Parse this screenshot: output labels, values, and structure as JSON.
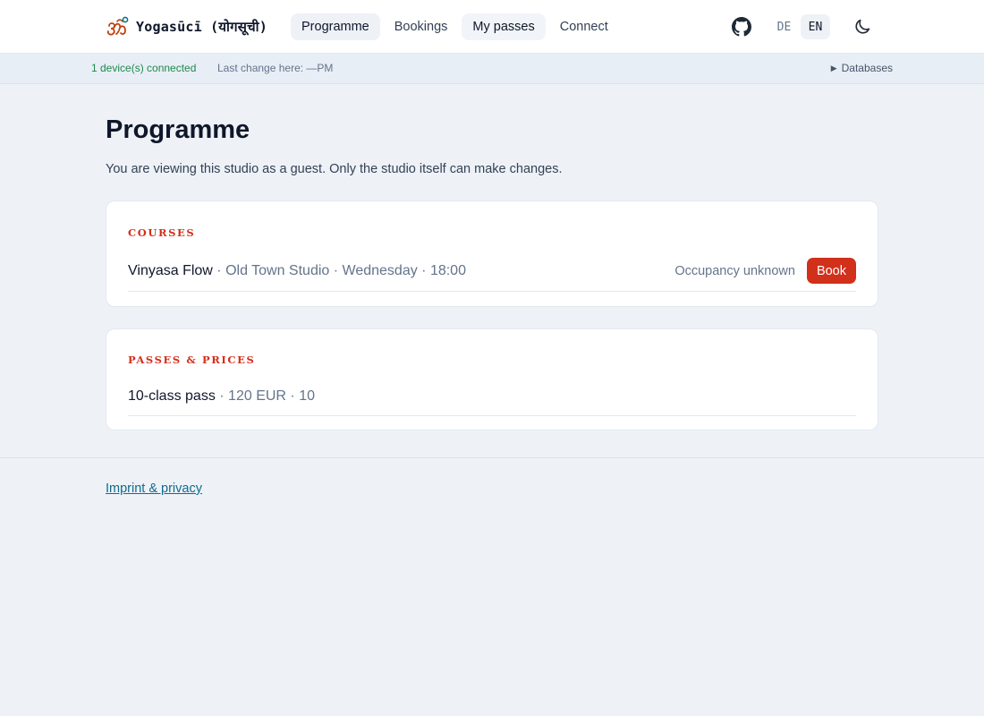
{
  "brand": {
    "name": "Yogasūcī (योगसूची)",
    "icon": "om-logo-icon"
  },
  "nav": {
    "items": [
      {
        "label": "Programme",
        "active": true
      },
      {
        "label": "Bookings",
        "active": false
      },
      {
        "label": "My passes",
        "active": false
      },
      {
        "label": "Connect",
        "active": false
      }
    ]
  },
  "header": {
    "github_icon": "github-icon",
    "languages": [
      {
        "label": "DE",
        "active": false
      },
      {
        "label": "EN",
        "active": true
      }
    ],
    "theme_icon": "moon-icon"
  },
  "status": {
    "devices": "1 device(s) connected",
    "last_change": "Last change here: —PM",
    "databases": "Databases",
    "databases_icon": "triangle-right-icon"
  },
  "main": {
    "title": "Programme",
    "guest_note": "You are viewing this studio as a guest. Only the studio itself can make changes.",
    "courses": {
      "label": "COURSES",
      "items": [
        {
          "name": "Vinyasa Flow",
          "meta": " · Old Town Studio · Wednesday · 18:00",
          "occupancy": "Occupancy unknown",
          "book_label": "Book"
        }
      ]
    },
    "passes": {
      "label": "PASSES & PRICES",
      "items": [
        {
          "name": "10-class pass",
          "meta": " · 120 EUR · 10"
        }
      ]
    }
  },
  "footer": {
    "imprint": "Imprint & privacy"
  },
  "colors": {
    "accent": "#d1301b",
    "status_ok": "#1f8a4c",
    "background": "#eef2f7",
    "link": "#0f6b8f"
  }
}
